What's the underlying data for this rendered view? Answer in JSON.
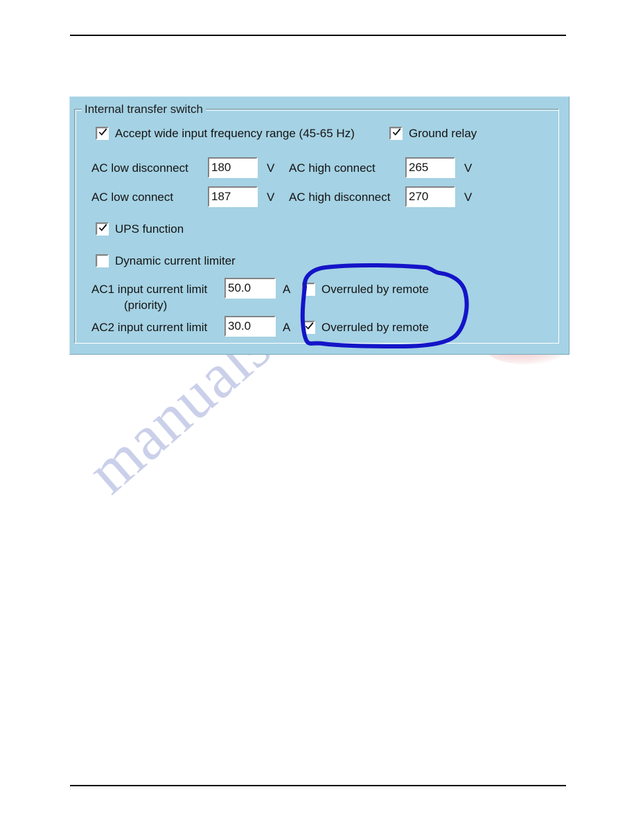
{
  "page": {
    "rules": {
      "top": true,
      "bottom": true
    },
    "watermark": {
      "text": "manualshive.com",
      "color": "#5566bb"
    }
  },
  "dialog": {
    "background_color": "#a5d2e4",
    "groupbox": {
      "title": "Internal transfer switch"
    },
    "checkboxes": {
      "accept_wide_freq": {
        "label": "Accept wide input frequency range (45-65 Hz)",
        "checked": true
      },
      "ground_relay": {
        "label": "Ground relay",
        "checked": true
      },
      "ups_function": {
        "label": "UPS function",
        "checked": true
      },
      "dynamic_current_limiter": {
        "label": "Dynamic current limiter",
        "checked": false
      },
      "ac1_overruled": {
        "label": "Overruled by remote",
        "checked": false
      },
      "ac2_overruled": {
        "label": "Overruled by remote",
        "checked": true
      }
    },
    "fields": {
      "ac_low_disconnect": {
        "label": "AC low disconnect",
        "value": "180",
        "unit": "V"
      },
      "ac_low_connect": {
        "label": "AC low connect",
        "value": "187",
        "unit": "V"
      },
      "ac_high_connect": {
        "label": "AC high connect",
        "value": "265",
        "unit": "V"
      },
      "ac_high_disconnect": {
        "label": "AC high disconnect",
        "value": "270",
        "unit": "V"
      },
      "ac1_input_current_limit": {
        "label": "AC1 input current limit",
        "label_line2": "(priority)",
        "value": "50.0",
        "unit": "A"
      },
      "ac2_input_current_limit": {
        "label": "AC2 input current limit",
        "value": "30.0",
        "unit": "A"
      }
    },
    "annotation": {
      "type": "hand-drawn-circle",
      "color": "#1414c8",
      "encircles": "AC1 and AC2 Overruled by remote checkboxes"
    }
  }
}
